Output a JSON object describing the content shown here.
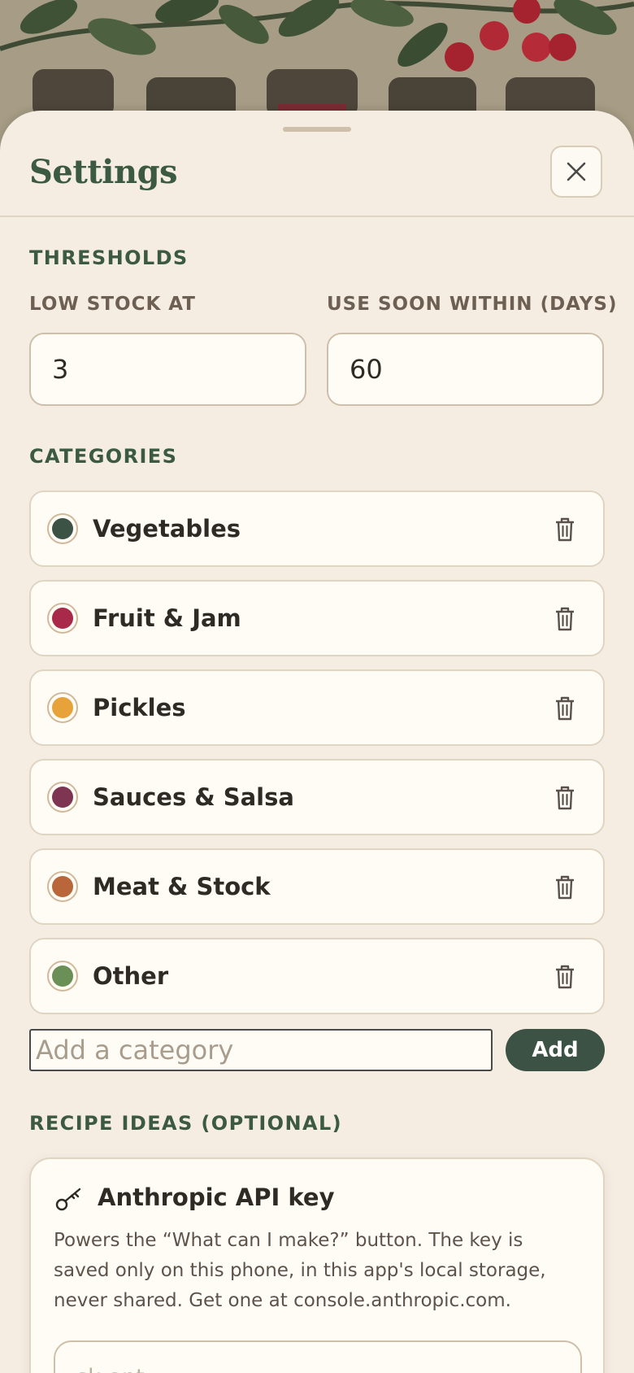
{
  "header": {
    "title": "Settings",
    "close_icon": "close-icon"
  },
  "thresholds": {
    "section_label": "THRESHOLDS",
    "low_stock_label": "LOW STOCK AT",
    "low_stock_value": "3",
    "use_soon_label": "USE SOON WITHIN (DAYS)",
    "use_soon_value": "60"
  },
  "categories": {
    "section_label": "CATEGORIES",
    "items": [
      {
        "name": "Vegetables",
        "color": "#3b5244"
      },
      {
        "name": "Fruit & Jam",
        "color": "#a8294a"
      },
      {
        "name": "Pickles",
        "color": "#e8a23a"
      },
      {
        "name": "Sauces & Salsa",
        "color": "#7d3552"
      },
      {
        "name": "Meat & Stock",
        "color": "#b9673a"
      },
      {
        "name": "Other",
        "color": "#6a8f57"
      }
    ],
    "add_placeholder": "Add a category",
    "add_button": "Add"
  },
  "recipes": {
    "section_label": "RECIPE IDEAS (OPTIONAL)",
    "api_title": "Anthropic API key",
    "api_description": "Powers the “What can I make?” button. The key is saved only on this phone, in this app's local storage, never shared. Get one at console.anthropic.com.",
    "api_placeholder": "sk-ant-"
  }
}
